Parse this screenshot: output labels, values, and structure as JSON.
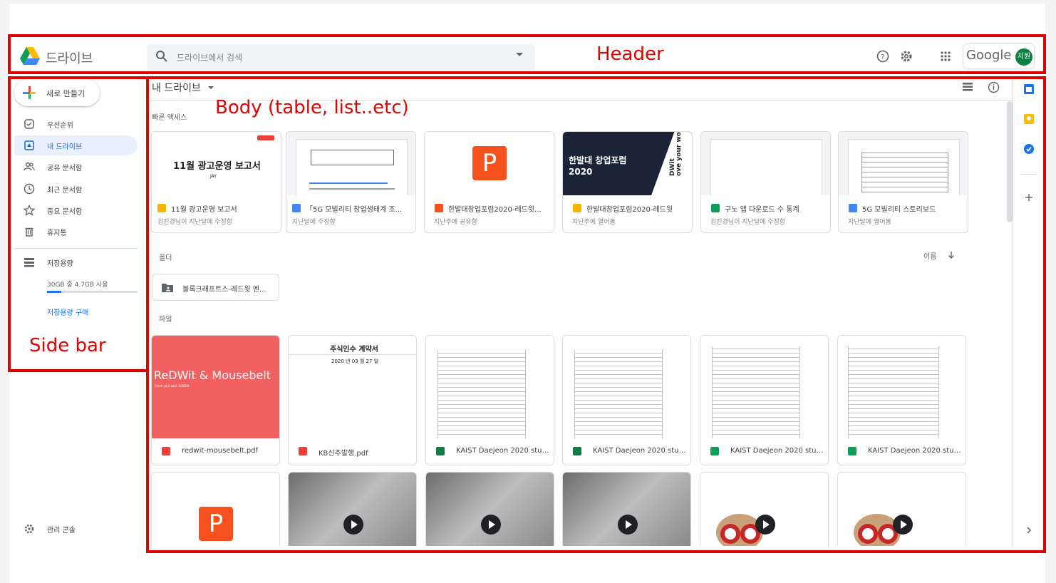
{
  "app": {
    "name": "드라이브"
  },
  "search": {
    "placeholder": "드라이브에서 검색"
  },
  "header": {
    "google_label": "Google",
    "avatar_initials": "지원"
  },
  "annotations": {
    "header": "Header",
    "body": "Body (table, list..etc)",
    "sidebar": "Side bar"
  },
  "sidebar": {
    "new_label": "새로 만들기",
    "items": [
      {
        "label": "우선순위",
        "icon": "priority-icon"
      },
      {
        "label": "내 드라이브",
        "icon": "my-drive-icon",
        "active": true
      },
      {
        "label": "공유 문서함",
        "icon": "shared-icon"
      },
      {
        "label": "최근 문서함",
        "icon": "recent-icon"
      },
      {
        "label": "중요 문서함",
        "icon": "star-icon"
      },
      {
        "label": "휴지통",
        "icon": "trash-icon"
      }
    ],
    "storage_label": "저장용량",
    "storage_usage": "30GB 중 4.7GB 사용",
    "storage_fraction": 0.16,
    "storage_buy": "저장용량 구매",
    "admin_console": "관리 콘솔"
  },
  "body": {
    "breadcrumb": "내 드라이브",
    "quick_access_label": "빠른 액세스",
    "quick_access": [
      {
        "title": "11월 광고운영 보고서",
        "sub": "김진경님이 지난달에 수정함",
        "type": "slides",
        "thumb_title": "11월 광고운영 보고서",
        "thumb_sub": "JAY"
      },
      {
        "title": "「5G 모빌리티 창업생태계 조...",
        "sub": "지난달에 수정함",
        "type": "docs"
      },
      {
        "title": "한발대창업포럼2020-레드윗...",
        "sub": "지난주에 공유함",
        "type": "ppt",
        "thumb_letter": "P"
      },
      {
        "title": "한발대창업포럼2020-레드윗",
        "sub": "지난주에 열어봄",
        "type": "slides",
        "thumb_title": "한발대 창업포럼\n2020",
        "thumb_side": "DWit\nove your work"
      },
      {
        "title": "구노 앱 다운로드 수 통계",
        "sub": "김진경님이 지난달에 수정함",
        "type": "sheets"
      },
      {
        "title": "5G 모빌리티 스토리보드",
        "sub": "지난달에 열어봄",
        "type": "docs"
      }
    ],
    "folders_label": "폴더",
    "sort_label": "이름",
    "folders": [
      {
        "name": "블록크래프트스-레드윗 멘..."
      }
    ],
    "files_label": "파일",
    "files": [
      {
        "name": "redwit-mousebelt.pdf",
        "type": "pdf",
        "thumb_title": "ReDWit & Mousebelt",
        "thumb_sub": "Prove your work ReDWit"
      },
      {
        "name": "KB신주발행.pdf",
        "type": "pdf",
        "thumb_title": "주식인수 계약서",
        "thumb_date": "2020 년 03 월 27 일"
      },
      {
        "name": "KAIST Daejeon 2020 stude...",
        "type": "excel"
      },
      {
        "name": "KAIST Daejeon 2020 stude...",
        "type": "excel"
      },
      {
        "name": "KAIST Daejeon 2020 stude...",
        "type": "sheets"
      },
      {
        "name": "KAIST Daejeon 2020 stude...",
        "type": "sheets"
      }
    ],
    "second_row_ppt_letter": "P"
  },
  "colors": {
    "accent": "#1a73e8",
    "annotation_red": "#e00000",
    "slides": "#f4b400",
    "docs": "#4285f4",
    "sheets": "#0f9d58",
    "ppt": "#f4511e",
    "pdf": "#ea4335",
    "excel": "#107c41"
  }
}
